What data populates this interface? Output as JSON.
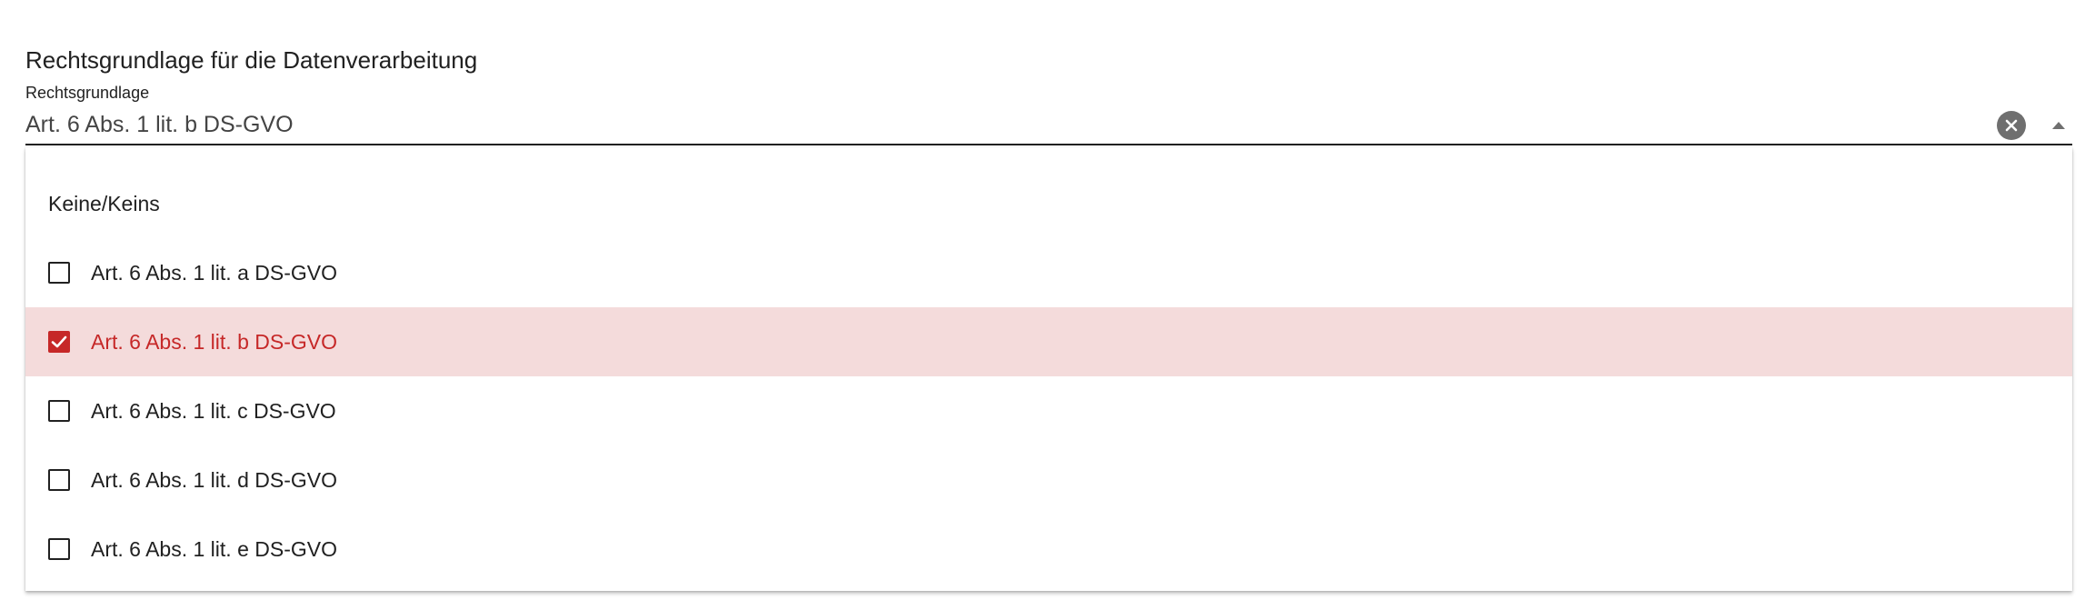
{
  "section": {
    "title": "Rechtsgrundlage für die Datenverarbeitung"
  },
  "field": {
    "label": "Rechtsgrundlage",
    "value": "Art. 6 Abs. 1 lit. b DS-GVO",
    "clear_icon": "clear-circle-icon",
    "toggle_icon": "arrow-up-icon"
  },
  "dropdown": {
    "none_option": "Keine/Keins",
    "options": [
      {
        "label": "Art. 6 Abs. 1 lit. a DS-GVO",
        "checked": false
      },
      {
        "label": "Art. 6 Abs. 1 lit. b DS-GVO",
        "checked": true
      },
      {
        "label": "Art. 6 Abs. 1 lit. c DS-GVO",
        "checked": false
      },
      {
        "label": "Art. 6 Abs. 1 lit. d DS-GVO",
        "checked": false
      },
      {
        "label": "Art. 6 Abs. 1 lit. e DS-GVO",
        "checked": false
      }
    ]
  },
  "colors": {
    "accent": "#c62828",
    "selected_background": "#f4dbdb",
    "clear_icon_background": "#6f6f6f"
  }
}
